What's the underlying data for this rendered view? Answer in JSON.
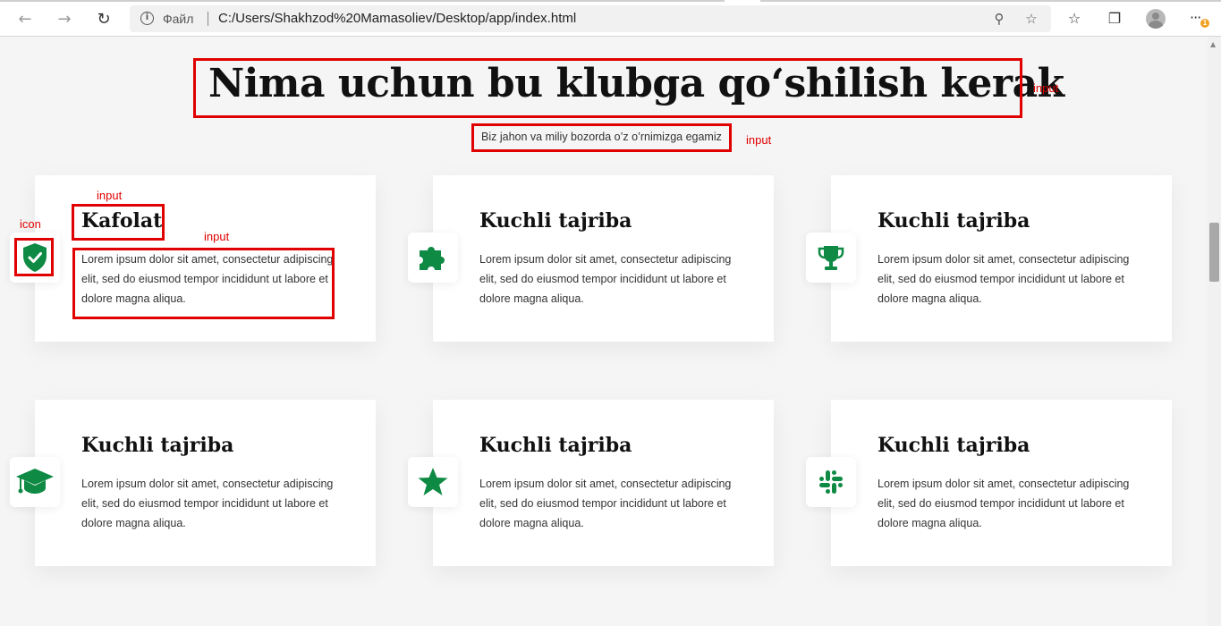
{
  "browser": {
    "site_label": "Файл",
    "url": "C:/Users/Shakhzod%20Mamasoliev/Desktop/app/index.html",
    "notification_count": "1",
    "icons": [
      "back-icon",
      "forward-icon",
      "refresh-icon",
      "info-icon",
      "zoom-icon",
      "add-favorite-icon",
      "favorites-icon",
      "collections-icon",
      "profile-icon",
      "more-icon"
    ]
  },
  "page": {
    "title": "Nima uchun bu klubga qo‘shilish kerak",
    "subtitle": "Biz jahon va miliy bozorda o’z o’rnimizga egamiz"
  },
  "cards": [
    {
      "title": "Kafolat",
      "text": "Lorem ipsum dolor sit amet, consectetur adipiscing elit, sed do eiusmod tempor incididunt ut labore et dolore magna aliqua.",
      "icon": "shield-check-icon"
    },
    {
      "title": "Kuchli tajriba",
      "text": "Lorem ipsum dolor sit amet, consectetur adipiscing elit, sed do eiusmod tempor incididunt ut labore et dolore magna aliqua.",
      "icon": "puzzle-icon"
    },
    {
      "title": "Kuchli tajriba",
      "text": "Lorem ipsum dolor sit amet, consectetur adipiscing elit, sed do eiusmod tempor incididunt ut labore et dolore magna aliqua.",
      "icon": "trophy-icon"
    },
    {
      "title": "Kuchli tajriba",
      "text": "Lorem ipsum dolor sit amet, consectetur adipiscing elit, sed do eiusmod tempor incididunt ut labore et dolore magna aliqua.",
      "icon": "graduation-cap-icon"
    },
    {
      "title": "Kuchli tajriba",
      "text": "Lorem ipsum dolor sit amet, consectetur adipiscing elit, sed do eiusmod tempor incididunt ut labore et dolore magna aliqua.",
      "icon": "star-icon"
    },
    {
      "title": "Kuchli tajriba",
      "text": "Lorem ipsum dolor sit amet, consectetur adipiscing elit, sed do eiusmod tempor incididunt ut labore et dolore magna aliqua.",
      "icon": "slack-icon"
    }
  ],
  "annotations": {
    "title_label": "input",
    "subtitle_label": "input",
    "card_title_label": "input",
    "card_icon_label": "icon",
    "card_text_label": "input"
  },
  "colors": {
    "accent": "#0e8a44",
    "annotation": "#e00000",
    "background": "#f5f5f5"
  }
}
